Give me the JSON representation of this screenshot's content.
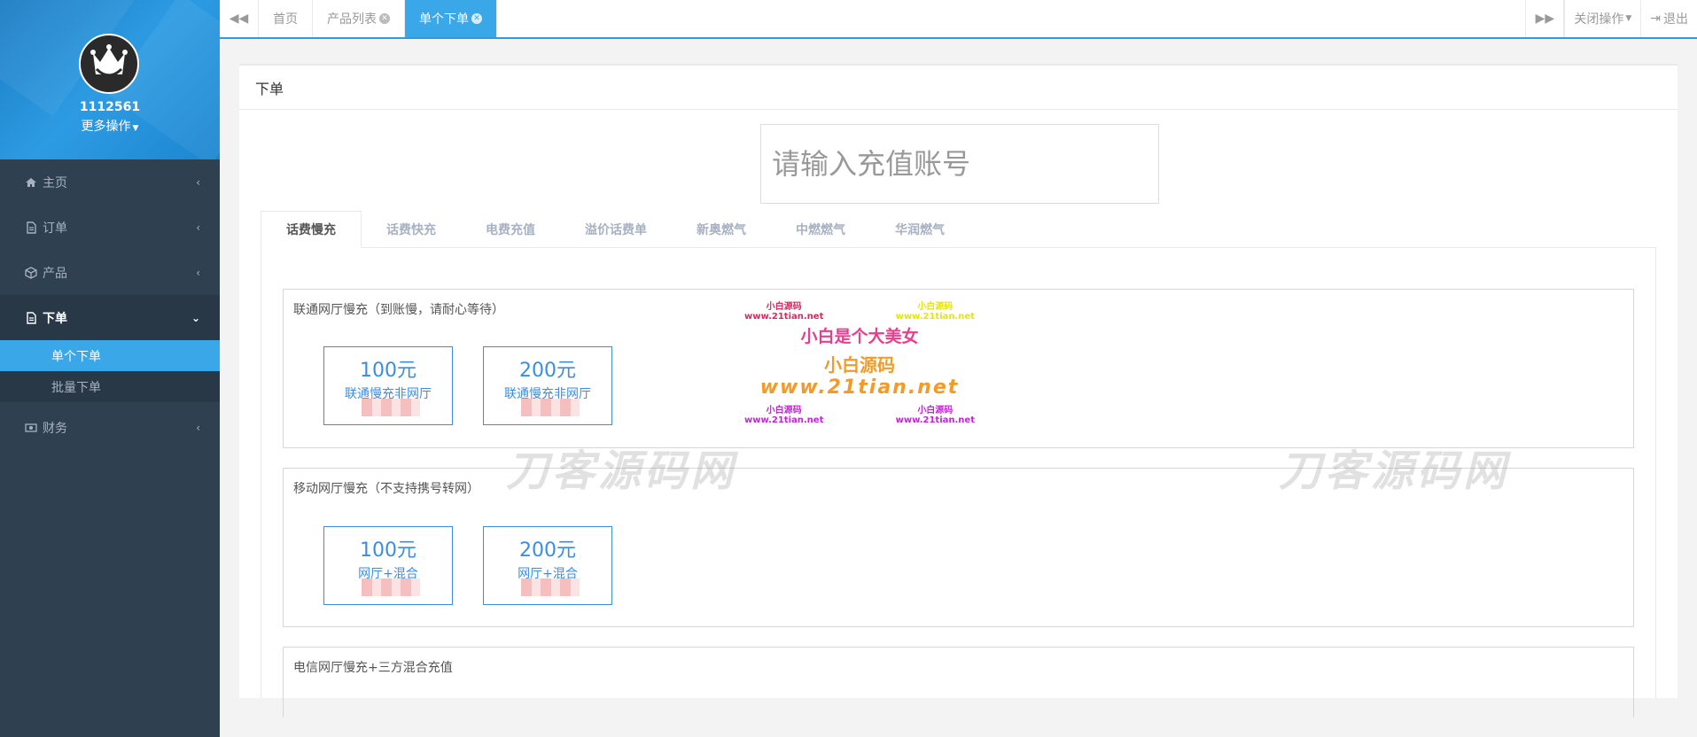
{
  "sidebar": {
    "user_id": "1112561",
    "more_ops": "更多操作",
    "menu": [
      {
        "label": "主页",
        "icon": "home-icon"
      },
      {
        "label": "订单",
        "icon": "file-icon"
      },
      {
        "label": "产品",
        "icon": "cube-icon"
      },
      {
        "label": "下单",
        "icon": "file-text-icon"
      },
      {
        "label": "财务",
        "icon": "money-icon"
      }
    ],
    "submenu": [
      "单个下单",
      "批量下单"
    ]
  },
  "topbar": {
    "tabs": [
      "首页",
      "产品列表",
      "单个下单"
    ],
    "close_ops": "关闭操作",
    "logout": "退出"
  },
  "panel": {
    "title": "下单",
    "account_placeholder": "请输入充值账号",
    "tabs": [
      "话费慢充",
      "话费快充",
      "电费充值",
      "溢价话费单",
      "新奥燃气",
      "中燃燃气",
      "华润燃气"
    ],
    "groups": [
      {
        "title": "联通网厅慢充（到账慢，请耐心等待）",
        "cards": [
          {
            "amount": "100元",
            "desc": "联通慢充非网厅"
          },
          {
            "amount": "200元",
            "desc": "联通慢充非网厅"
          }
        ]
      },
      {
        "title": "移动网厅慢充（不支持携号转网）",
        "cards": [
          {
            "amount": "100元",
            "desc": "网厅+混合"
          },
          {
            "amount": "200元",
            "desc": "网厅+混合"
          }
        ]
      },
      {
        "title": "电信网厅慢充+三方混合充值",
        "cards": []
      }
    ]
  },
  "watermarks": {
    "main": "刀客源码网",
    "promo_small1": "小白源码",
    "promo_url_small": "www.21tian.net",
    "promo_big": "小白是个大美女",
    "promo_mid": "小白源码",
    "promo_url": "www.21tian.net"
  }
}
